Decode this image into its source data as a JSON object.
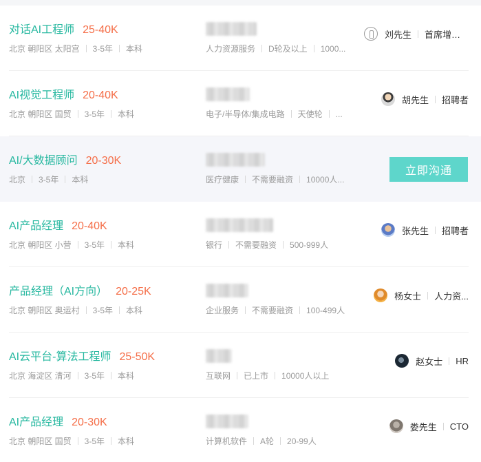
{
  "jobs": [
    {
      "title": "对话AI工程师",
      "salary": "25-40K",
      "location": "北京 朝阳区 太阳宫",
      "experience": "3-5年",
      "education": "本科",
      "company_tags": [
        "人力资源服务",
        "D轮及以上",
        "1000..."
      ],
      "recruiter": {
        "name": "刘先生",
        "role": "首席增长官",
        "avatar_icon": "placeholder-avatar-icon"
      }
    },
    {
      "title": "AI视觉工程师",
      "salary": "20-40K",
      "location": "北京 朝阳区 国贸",
      "experience": "3-5年",
      "education": "本科",
      "company_tags": [
        "电子/半导体/集成电路",
        "天使轮",
        "..."
      ],
      "recruiter": {
        "name": "胡先生",
        "role": "招聘者",
        "avatar_icon": "user-avatar"
      }
    },
    {
      "title": "AI/大数据顾问",
      "salary": "20-30K",
      "location": "北京",
      "experience": "3-5年",
      "education": "本科",
      "company_tags": [
        "医疗健康",
        "不需要融资",
        "10000人..."
      ],
      "chat_button_label": "立即沟通"
    },
    {
      "title": "AI产品经理",
      "salary": "20-40K",
      "location": "北京 朝阳区 小营",
      "experience": "3-5年",
      "education": "本科",
      "company_tags": [
        "银行",
        "不需要融资",
        "500-999人"
      ],
      "recruiter": {
        "name": "张先生",
        "role": "招聘者",
        "avatar_icon": "user-avatar"
      }
    },
    {
      "title": "产品经理（AI方向）",
      "salary": "20-25K",
      "location": "北京 朝阳区 奥运村",
      "experience": "3-5年",
      "education": "本科",
      "company_tags": [
        "企业服务",
        "不需要融资",
        "100-499人"
      ],
      "recruiter": {
        "name": "杨女士",
        "role": "人力资...",
        "avatar_icon": "user-avatar"
      }
    },
    {
      "title": "AI云平台-算法工程师",
      "salary": "25-50K",
      "location": "北京 海淀区 清河",
      "experience": "3-5年",
      "education": "本科",
      "company_tags": [
        "互联网",
        "已上市",
        "10000人以上"
      ],
      "recruiter": {
        "name": "赵女士",
        "role": "HR",
        "avatar_icon": "user-avatar"
      }
    },
    {
      "title": "AI产品经理",
      "salary": "20-30K",
      "location": "北京 朝阳区 国贸",
      "experience": "3-5年",
      "education": "本科",
      "company_tags": [
        "计算机软件",
        "A轮",
        "20-99人"
      ],
      "recruiter": {
        "name": "娄先生",
        "role": "CTO",
        "avatar_icon": "user-avatar"
      }
    }
  ],
  "colors": {
    "title": "#27b8a0",
    "salary": "#f56e48",
    "meta": "#9a9a9a",
    "chat_button": "#5ed6cb",
    "highlight_row": "#f5f6fa"
  }
}
